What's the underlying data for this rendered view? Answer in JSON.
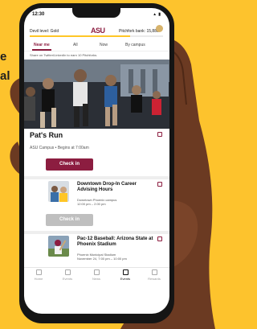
{
  "background": {
    "lines": [
      "e",
      "al"
    ],
    "color": "#fdc32d"
  },
  "status_bar": {
    "time": "12:30",
    "icons": "▴ ▮"
  },
  "header": {
    "devil_level": "Devil level: Gold",
    "logo": "ASU",
    "pitchfork_bank": "Pitchfork bank: 15,880",
    "progress_fraction": 0.75
  },
  "tabs": [
    {
      "label": "Near me",
      "active": true
    },
    {
      "label": "All",
      "active": false
    },
    {
      "label": "Now",
      "active": false
    },
    {
      "label": "By campus",
      "active": false
    }
  ],
  "subnote": "Share on Twitter/LinkedIn to earn 10 Pitchforks.",
  "featured": {
    "title": "Pat's Run",
    "meta": "ASU Campus  •  Begins at 7:00am",
    "button": "Check in"
  },
  "events": [
    {
      "title": "Downtown Drop-In Career Advising Hours",
      "meta": "Downtown Phoenix campus\n12:00 pm – 2:00 pm",
      "button": "Check in"
    },
    {
      "title": "Pac-12 Baseball: Arizona State at Phoenix Stadium",
      "meta": "Phoenix Municipal Stadium\nNovember 24, 7:00 pm – 10:00 pm"
    }
  ],
  "bottom_nav": [
    {
      "label": "Home",
      "icon": "home-icon"
    },
    {
      "label": "Events",
      "icon": "ticket-icon"
    },
    {
      "label": "News",
      "icon": "news-icon"
    },
    {
      "label": "Events",
      "icon": "calendar-icon",
      "active": true
    },
    {
      "label": "Rewards",
      "icon": "trophy-icon"
    }
  ],
  "colors": {
    "maroon": "#8c1d40",
    "gold": "#ffc627",
    "disabled": "#bfbfbf"
  }
}
